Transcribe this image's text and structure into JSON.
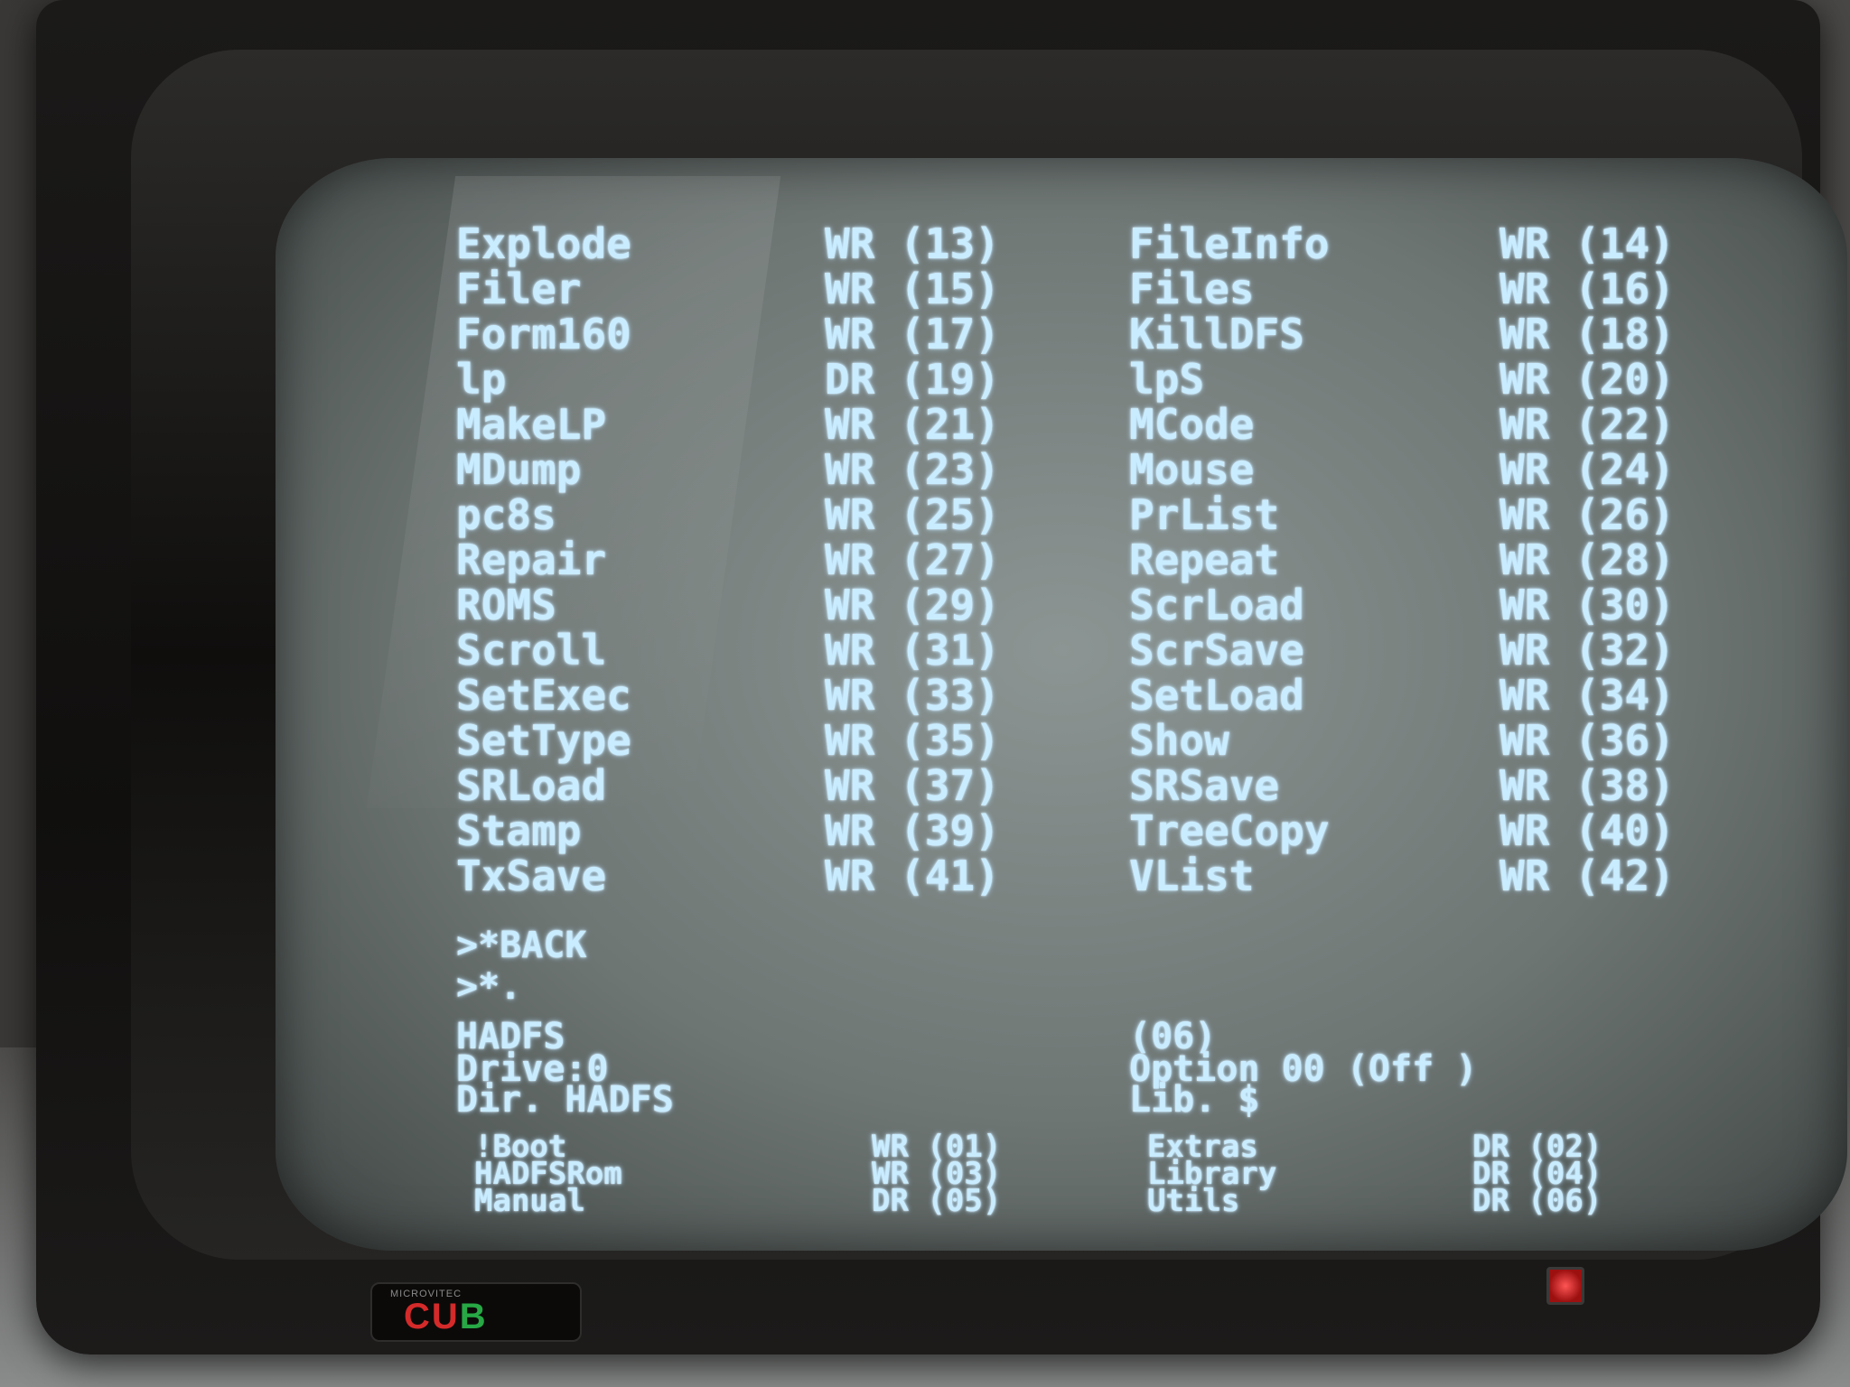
{
  "listing": [
    [
      "Explode",
      "WR (13)",
      "FileInfo",
      "WR (14)"
    ],
    [
      "Filer",
      "WR (15)",
      "Files",
      "WR (16)"
    ],
    [
      "Form160",
      "WR (17)",
      "KillDFS",
      "WR (18)"
    ],
    [
      "lp",
      "DR (19)",
      "lpS",
      "WR (20)"
    ],
    [
      "MakeLP",
      "WR (21)",
      "MCode",
      "WR (22)"
    ],
    [
      "MDump",
      "WR (23)",
      "Mouse",
      "WR (24)"
    ],
    [
      "pc8s",
      "WR (25)",
      "PrList",
      "WR (26)"
    ],
    [
      "Repair",
      "WR (27)",
      "Repeat",
      "WR (28)"
    ],
    [
      "ROMS",
      "WR (29)",
      "ScrLoad",
      "WR (30)"
    ],
    [
      "Scroll",
      "WR (31)",
      "ScrSave",
      "WR (32)"
    ],
    [
      "SetExec",
      "WR (33)",
      "SetLoad",
      "WR (34)"
    ],
    [
      "SetType",
      "WR (35)",
      "Show",
      "WR (36)"
    ],
    [
      "SRLoad",
      "WR (37)",
      "SRSave",
      "WR (38)"
    ],
    [
      "Stamp",
      "WR (39)",
      "TreeCopy",
      "WR (40)"
    ],
    [
      "TxSave",
      "WR (41)",
      "VList",
      "WR (42)"
    ]
  ],
  "commands": {
    "back": ">*BACK",
    "cat": ">*."
  },
  "catalogue_header": {
    "title": "HADFS",
    "cycle": "(06)",
    "drive": "Drive:0",
    "option": "Option 00 (Off )",
    "dir": "Dir. HADFS",
    "lib": "Lib. $"
  },
  "catalogue": [
    [
      "!Boot",
      "WR (01)",
      "Extras",
      "DR (02)"
    ],
    [
      "HADFSRom",
      "WR (03)",
      "Library",
      "DR (04)"
    ],
    [
      "Manual",
      "DR (05)",
      "Utils",
      "DR (06)"
    ]
  ],
  "prompt": ">",
  "badge": {
    "maker": "MICROVITEC",
    "brand_part1": "CU",
    "brand_part2": "B"
  },
  "colors": {
    "phosphor": "#c9ecff",
    "screen": "#7a8280",
    "led": "#ff3333"
  }
}
